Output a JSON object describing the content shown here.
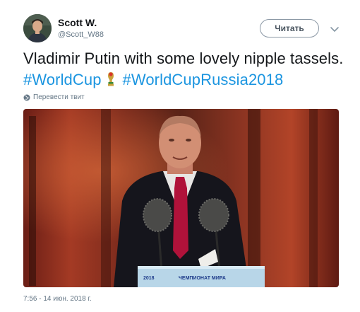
{
  "author": {
    "name": "Scott W.",
    "handle": "@Scott_W88"
  },
  "actions": {
    "follow_label": "Читать"
  },
  "tweet": {
    "text": "Vladimir Putin with some lovely nipple tassels.",
    "hashtags": [
      "#WorldCup",
      "#WorldCupRussia2018"
    ],
    "translate_label": "Перевести твит",
    "media_podium_text": "ЧЕМПИОНАТ МИРА",
    "timestamp": "7:56 - 14 июн. 2018 г."
  },
  "colors": {
    "hashtag": "#1b95e0",
    "secondary_text": "#657786"
  },
  "icons": {
    "translate": "globe-icon",
    "more": "chevron-down-icon",
    "trophy": "trophy-icon"
  }
}
